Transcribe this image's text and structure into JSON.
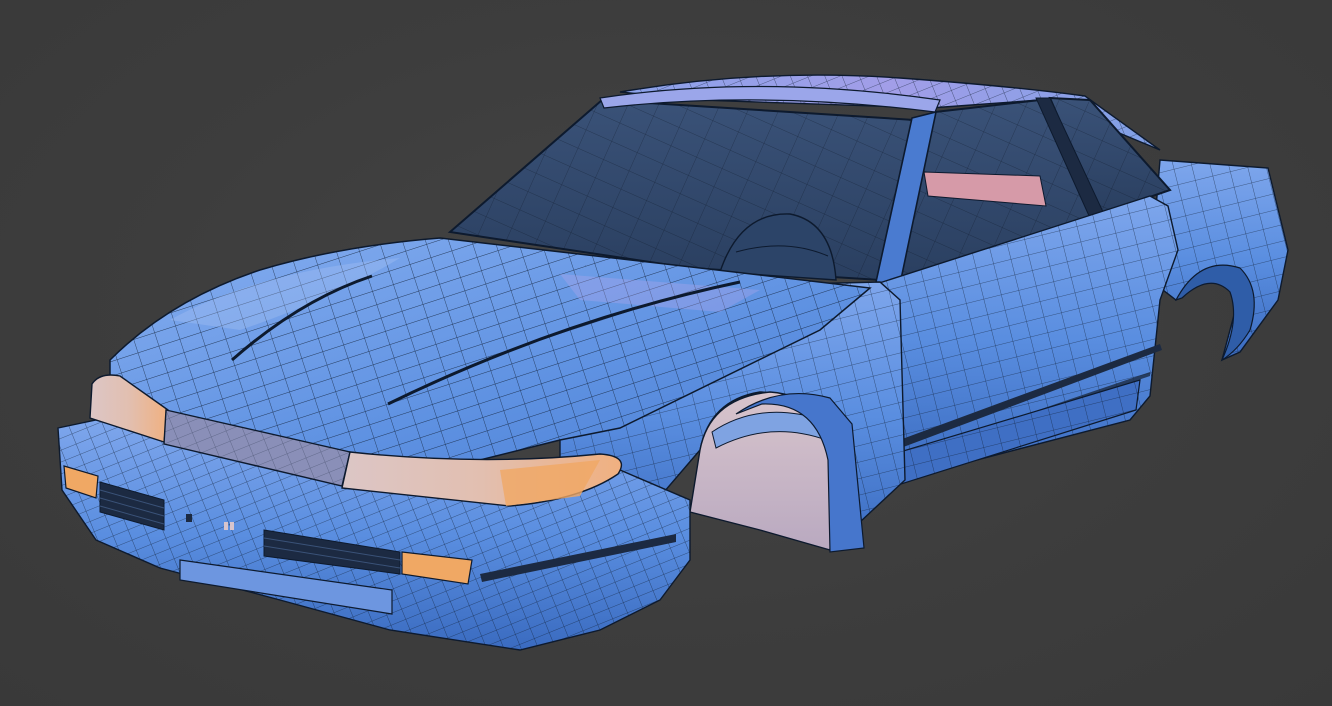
{
  "viewport": {
    "background_color": "#3d3d3d",
    "shading_mode": "solid-wireframe"
  },
  "model": {
    "subject": "car-body-mesh",
    "body_color": "#5a8ee0",
    "body_highlight_color": "#8fb6f0",
    "body_shadow_color": "#2f5da8",
    "wire_color": "#0d1a2e",
    "glass_color": "#2e4466",
    "headlight_color": "#e6b585",
    "indicator_color": "#f0a864",
    "interior_accent_color": "#d69aa8",
    "trim_color": "#1c2a42"
  }
}
